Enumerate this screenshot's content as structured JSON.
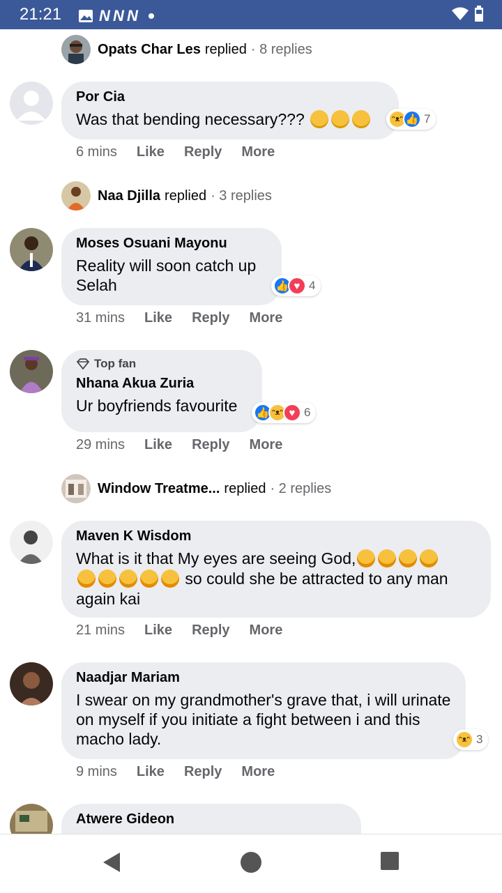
{
  "status_bar": {
    "time": "21:21",
    "notif_label": "N N N"
  },
  "thread": [
    {
      "type": "reply_summary",
      "name": "Opats Char Les",
      "verb": "replied",
      "meta": "· 8 replies"
    },
    {
      "type": "comment",
      "name": "Por Cia",
      "text": "Was that bending necessary???",
      "reactions": [
        "haha",
        "like"
      ],
      "reaction_count": "7",
      "time": "6 mins"
    },
    {
      "type": "reply_summary",
      "name": "Naa Djilla",
      "verb": "replied",
      "meta": "· 3 replies"
    },
    {
      "type": "comment",
      "name": "Moses Osuani Mayonu",
      "text": "Reality will soon catch up Selah",
      "reactions": [
        "like",
        "love"
      ],
      "reaction_count": "4",
      "time": "31 mins"
    },
    {
      "type": "comment",
      "badge": "Top fan",
      "name": "Nhana Akua Zuria",
      "text": "Ur boyfriends favourite",
      "reactions": [
        "like",
        "haha",
        "love"
      ],
      "reaction_count": "6",
      "time": "29 mins"
    },
    {
      "type": "reply_summary",
      "name": "Window Treatme...",
      "verb": "replied",
      "meta": "· 2 replies"
    },
    {
      "type": "comment",
      "name": "Maven K Wisdom",
      "text_line1": "What is it that My eyes are seeing God,",
      "text_line2": "so could she be attracted to any man",
      "text_line3": "again kai",
      "time": "21 mins"
    },
    {
      "type": "comment",
      "name": "Naadjar Mariam",
      "text": "I swear on my grandmother's grave that, i will urinate on myself if you initiate a fight between i and this macho lady.",
      "reactions": [
        "haha"
      ],
      "reaction_count": "3",
      "time": "9 mins"
    },
    {
      "type": "comment",
      "name": "Atwere Gideon"
    }
  ],
  "actions": {
    "like": "Like",
    "reply": "Reply",
    "more": "More"
  },
  "colors": {
    "status_bar": "#3b5998",
    "bubble": "#ebedf0",
    "muted": "#65676b",
    "like": "#1877f2",
    "love": "#f33e58",
    "haha": "#f7c13e"
  }
}
